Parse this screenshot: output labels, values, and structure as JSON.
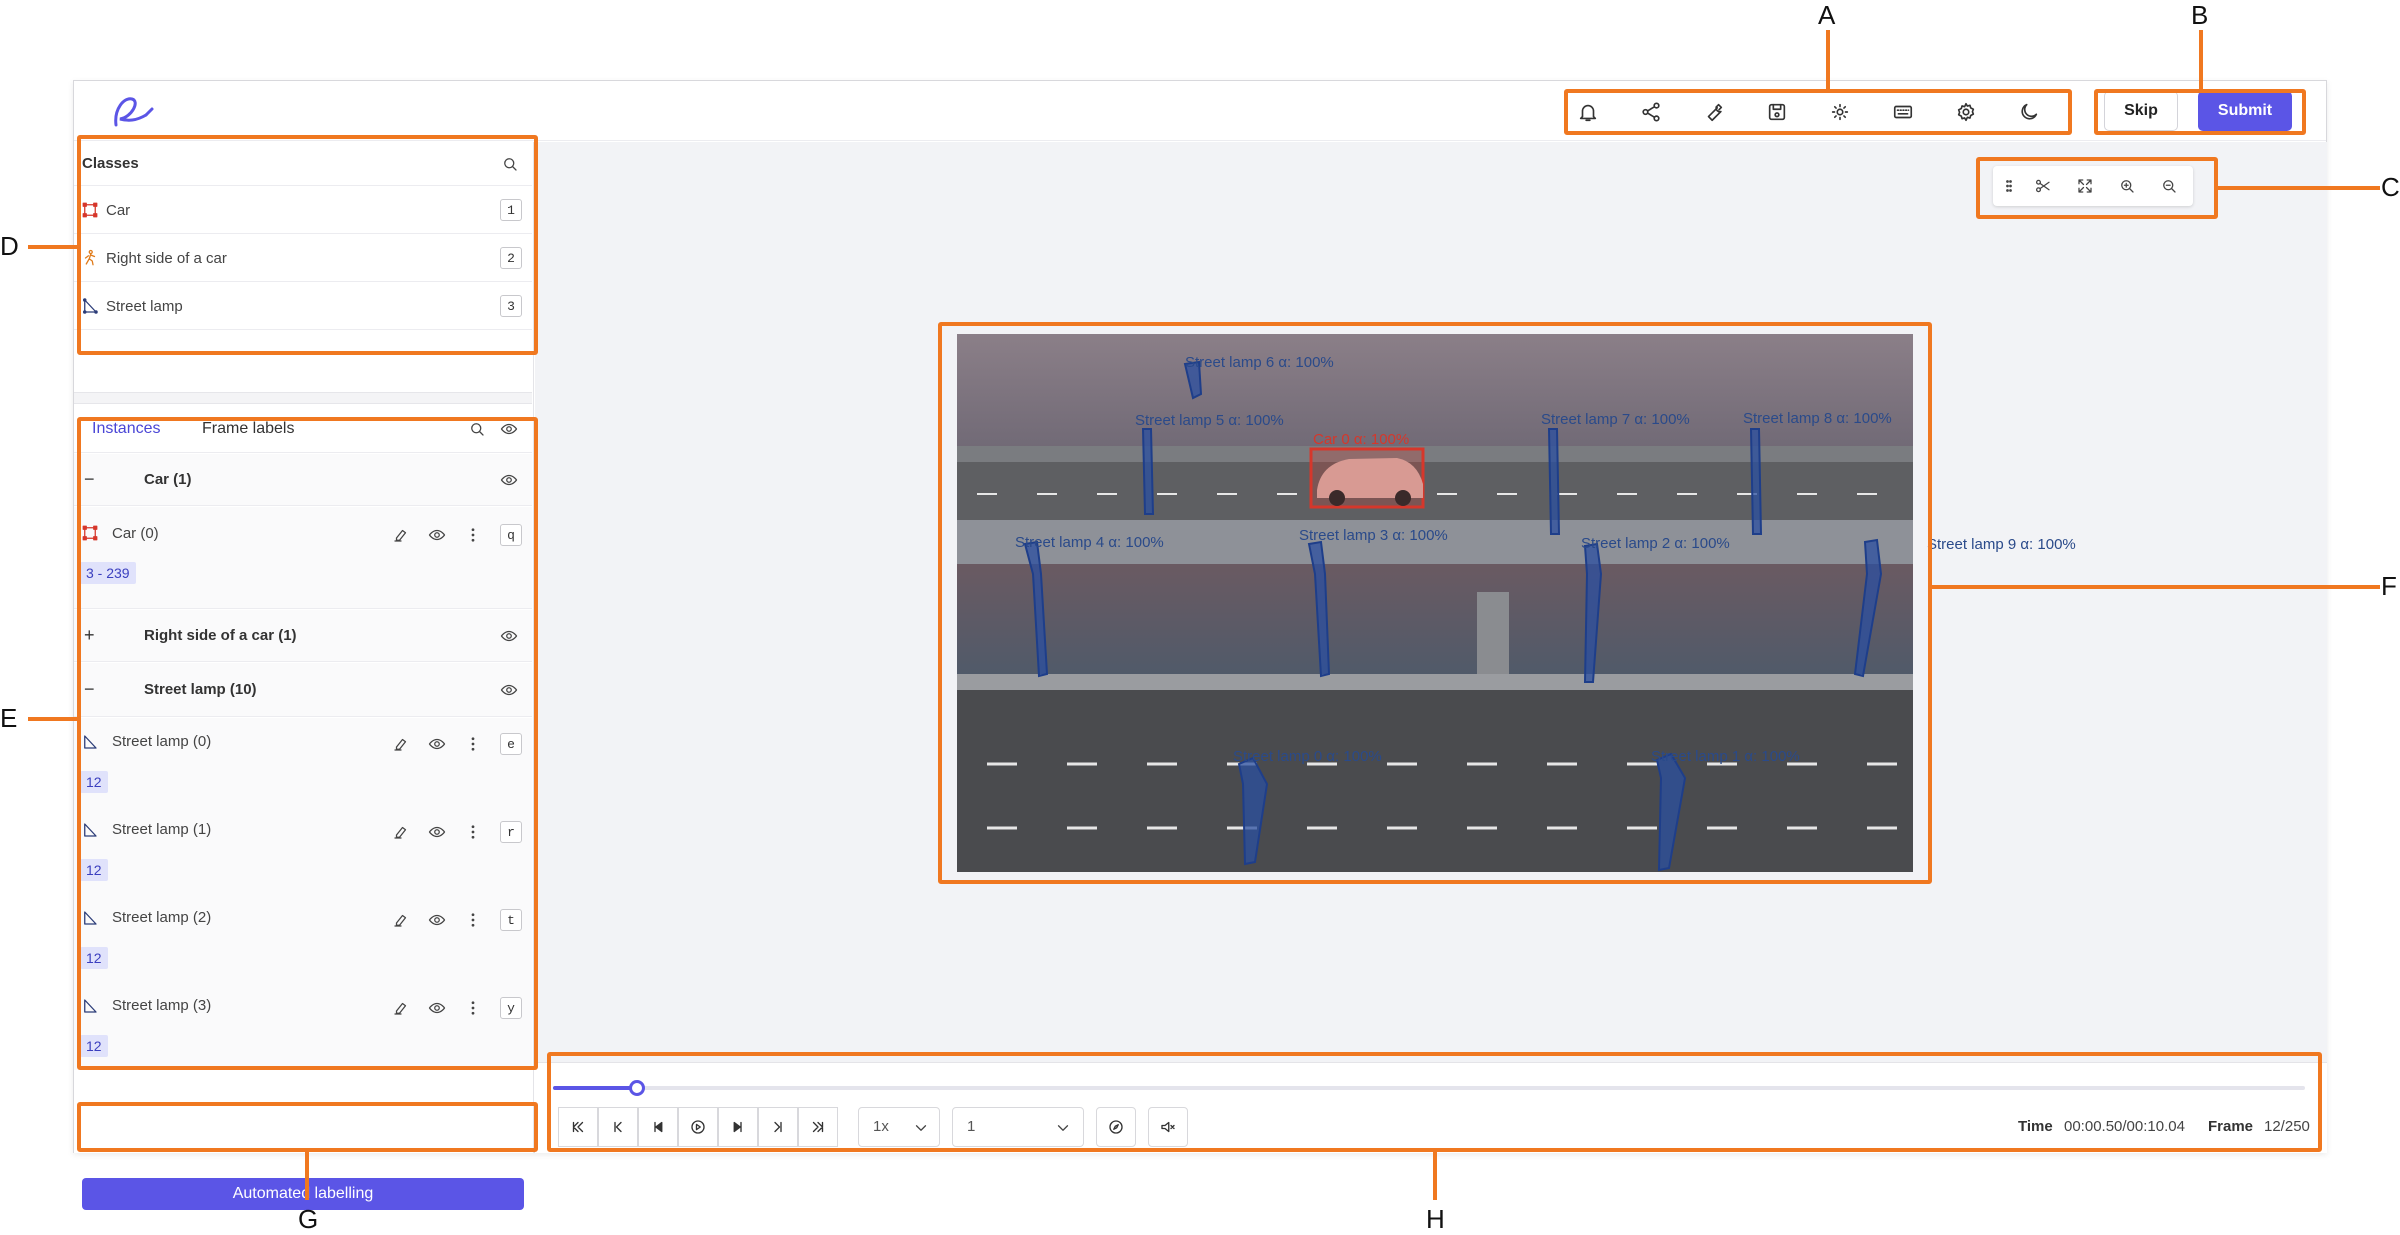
{
  "topbar": {
    "skip_label": "Skip",
    "submit_label": "Submit",
    "icons": [
      "bell-icon",
      "share-icon",
      "wrench-icon",
      "save-icon",
      "brightness-icon",
      "keyboard-icon",
      "gear-icon",
      "moon-icon"
    ]
  },
  "classes": {
    "header": "Classes",
    "items": [
      {
        "label": "Car",
        "key": "1",
        "icon": "bbox-icon",
        "color": "#d6372b"
      },
      {
        "label": "Right side of a car",
        "key": "2",
        "icon": "keypoint-icon",
        "color": "#e07b1a"
      },
      {
        "label": "Street lamp",
        "key": "3",
        "icon": "polygon-icon",
        "color": "#2b3c78"
      }
    ]
  },
  "instances": {
    "tab_instances": "Instances",
    "tab_frame_labels": "Frame labels",
    "groups": [
      {
        "toggle": "−",
        "label": "Car (1)"
      },
      {
        "toggle": "+",
        "label": "Right side of a car (1)"
      },
      {
        "toggle": "−",
        "label": "Street lamp (10)"
      }
    ],
    "items": [
      {
        "label": "Car (0)",
        "key": "q",
        "range": "3  -  239"
      },
      {
        "label": "Street lamp (0)",
        "key": "e",
        "range": "12"
      },
      {
        "label": "Street lamp (1)",
        "key": "r",
        "range": "12"
      },
      {
        "label": "Street lamp (2)",
        "key": "t",
        "range": "12"
      },
      {
        "label": "Street lamp (3)",
        "key": "y",
        "range": "12"
      }
    ]
  },
  "automated_labelling_label": "Automated labelling",
  "canvas": {
    "labels": [
      "Street lamp 6 α: 100%",
      "Street lamp 5 α: 100%",
      "Car 0 α: 100%",
      "Street lamp 7 α: 100%",
      "Street lamp 8 α: 100%",
      "Street lamp 4 α: 100%",
      "Street lamp 3 α: 100%",
      "Street lamp 2 α: 100%",
      "Street lamp 9 α: 100%",
      "Street lamp 0 α: 100%",
      "Street lamp 1 α: 100%"
    ]
  },
  "player": {
    "speed": "1x",
    "step": "1",
    "time_label": "Time",
    "time_value": "00:00.50/00:10.04",
    "frame_label": "Frame",
    "frame_value": "12/250",
    "progress": 0.048
  },
  "callouts": {
    "a": "A",
    "b": "B",
    "c": "C",
    "d": "D",
    "e": "E",
    "f": "F",
    "g": "G",
    "h": "H"
  },
  "colors": {
    "accent": "#5b55e6",
    "annotation_orange": "#f07820",
    "lamp_blue": "#2b4fa0",
    "car_red": "#d6372b"
  }
}
